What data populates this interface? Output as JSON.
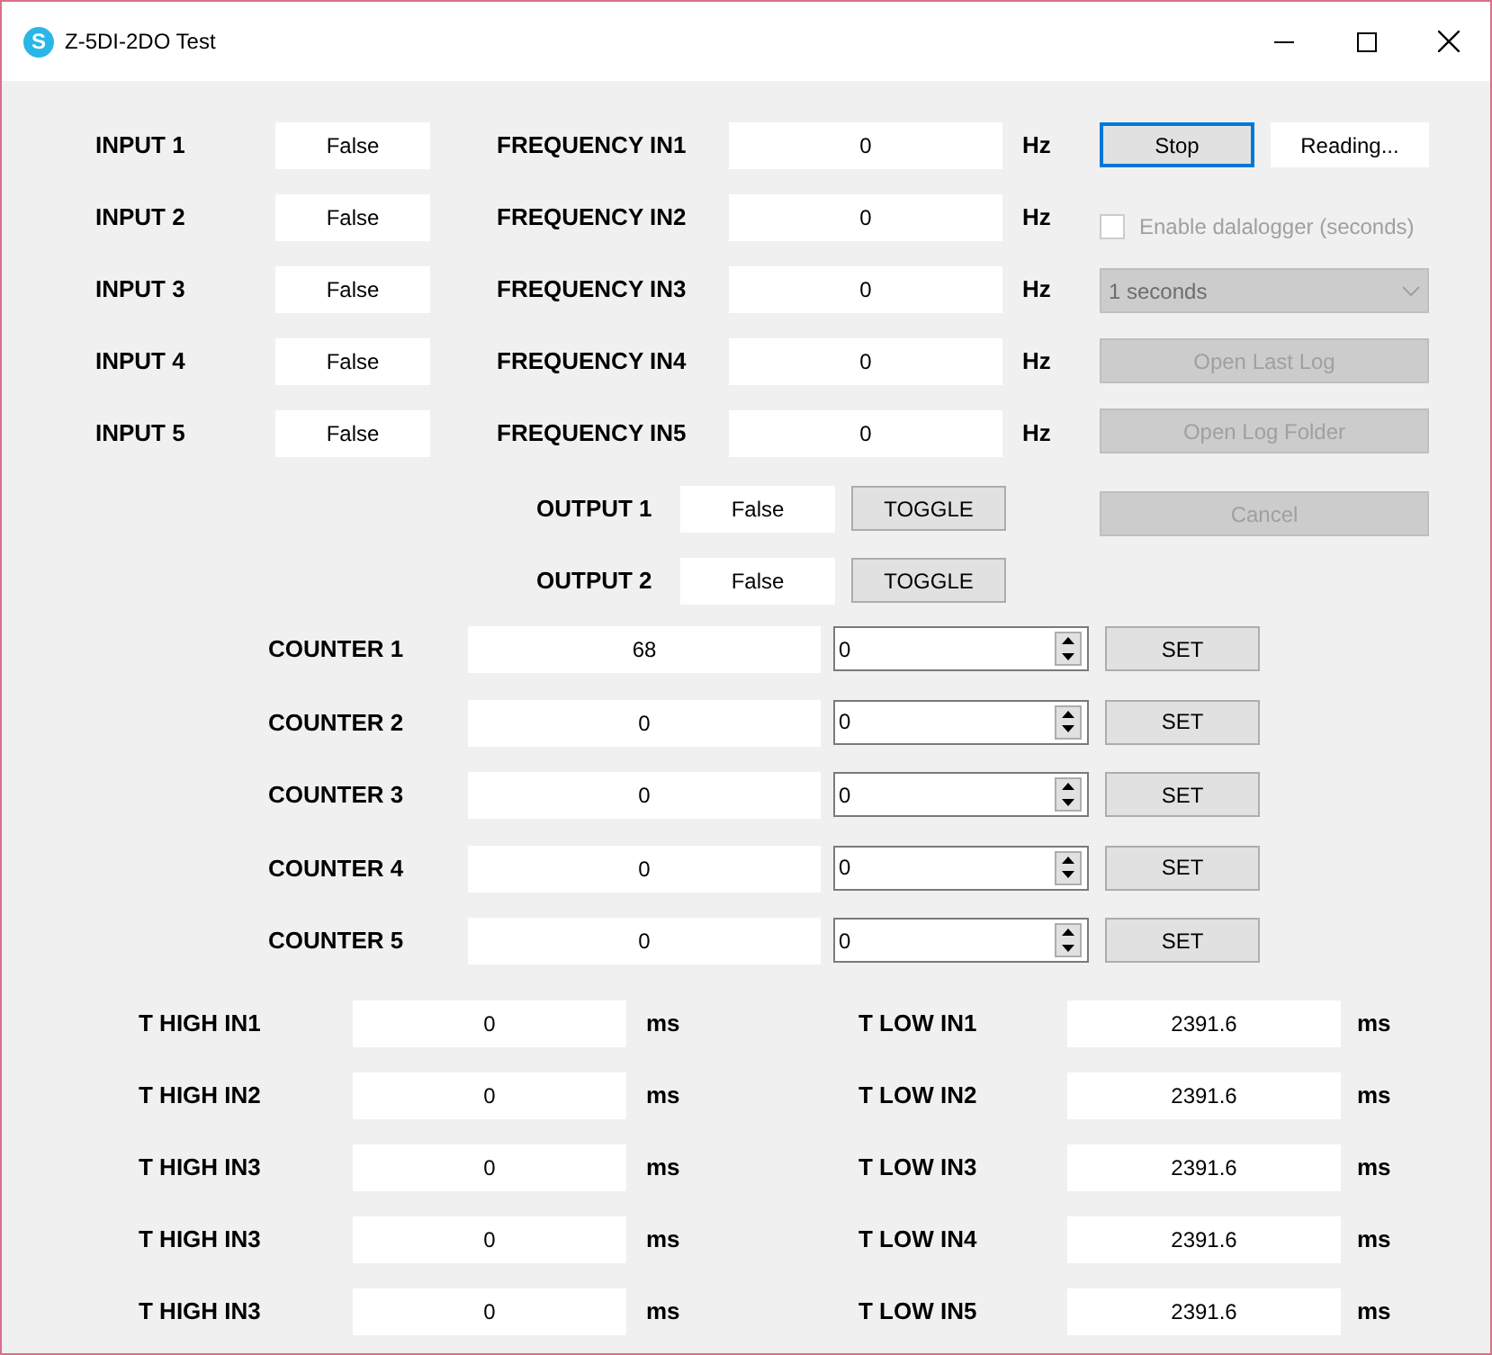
{
  "window": {
    "title": "Z-5DI-2DO Test",
    "icon_letter": "S"
  },
  "inputs": [
    {
      "label": "INPUT 1",
      "value": "False",
      "freq_label": "FREQUENCY IN1",
      "freq_value": "0",
      "unit": "Hz"
    },
    {
      "label": "INPUT 2",
      "value": "False",
      "freq_label": "FREQUENCY IN2",
      "freq_value": "0",
      "unit": "Hz"
    },
    {
      "label": "INPUT 3",
      "value": "False",
      "freq_label": "FREQUENCY IN3",
      "freq_value": "0",
      "unit": "Hz"
    },
    {
      "label": "INPUT 4",
      "value": "False",
      "freq_label": "FREQUENCY IN4",
      "freq_value": "0",
      "unit": "Hz"
    },
    {
      "label": "INPUT 5",
      "value": "False",
      "freq_label": "FREQUENCY IN5",
      "freq_value": "0",
      "unit": "Hz"
    }
  ],
  "outputs": [
    {
      "label": "OUTPUT 1",
      "value": "False",
      "button": "TOGGLE"
    },
    {
      "label": "OUTPUT 2",
      "value": "False",
      "button": "TOGGLE"
    }
  ],
  "control": {
    "button": "Stop",
    "focused": true,
    "status": "Reading..."
  },
  "datalogger": {
    "label": "Enable dalalogger (seconds)",
    "checked": false,
    "disabled": true
  },
  "interval": {
    "value": "1 seconds",
    "disabled": true
  },
  "log_buttons": [
    {
      "label": "Open Last Log",
      "disabled": true
    },
    {
      "label": "Open Log Folder",
      "disabled": true
    },
    {
      "label": "Cancel",
      "disabled": true
    }
  ],
  "counters": [
    {
      "label": "COUNTER 1",
      "value": "68",
      "setpoint": "0",
      "button": "SET"
    },
    {
      "label": "COUNTER 2",
      "value": "0",
      "setpoint": "0",
      "button": "SET"
    },
    {
      "label": "COUNTER 3",
      "value": "0",
      "setpoint": "0",
      "button": "SET"
    },
    {
      "label": "COUNTER 4",
      "value": "0",
      "setpoint": "0",
      "button": "SET"
    },
    {
      "label": "COUNTER 5",
      "value": "0",
      "setpoint": "0",
      "button": "SET"
    }
  ],
  "timings": [
    {
      "high_label": "T HIGH IN1",
      "high_value": "0",
      "high_unit": "ms",
      "low_label": "T LOW IN1",
      "low_value": "2391.6",
      "low_unit": "ms"
    },
    {
      "high_label": "T HIGH IN2",
      "high_value": "0",
      "high_unit": "ms",
      "low_label": "T LOW IN2",
      "low_value": "2391.6",
      "low_unit": "ms"
    },
    {
      "high_label": "T HIGH IN3",
      "high_value": "0",
      "high_unit": "ms",
      "low_label": "T LOW IN3",
      "low_value": "2391.6",
      "low_unit": "ms"
    },
    {
      "high_label": "T HIGH IN3",
      "high_value": "0",
      "high_unit": "ms",
      "low_label": "T LOW IN4",
      "low_value": "2391.6",
      "low_unit": "ms"
    },
    {
      "high_label": "T HIGH IN3",
      "high_value": "0",
      "high_unit": "ms",
      "low_label": "T LOW IN5",
      "low_value": "2391.6",
      "low_unit": "ms"
    }
  ]
}
